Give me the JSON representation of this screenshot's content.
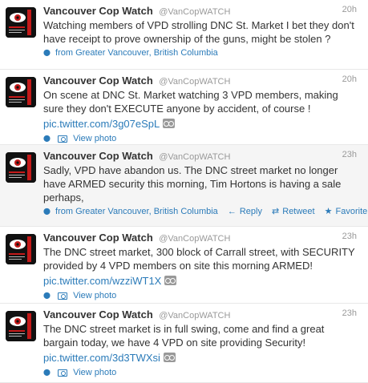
{
  "tweets": [
    {
      "fullname": "Vancouver Cop Watch",
      "username": "@VanCopWATCH",
      "time": "20h",
      "text": "Watching members of VPD strolling DNC St. Market I bet they don't have receipt to prove ownership of the guns, might be stolen ?",
      "location": "from Greater Vancouver, British Columbia"
    },
    {
      "fullname": "Vancouver Cop Watch",
      "username": "@VanCopWATCH",
      "time": "20h",
      "text": "On scene at DNC St. Market watching 3 VPD members, making sure they don't EXECUTE anyone by accident, of course !",
      "pic_link": "pic.twitter.com/3g07eSpL",
      "view_photo": "View photo"
    },
    {
      "fullname": "Vancouver Cop Watch",
      "username": "@VanCopWATCH",
      "time": "23h",
      "text": "Sadly, VPD have abandon us. The DNC street market no longer have ARMED security this morning, Tim Hortons is having a sale perhaps,",
      "location": "from Greater Vancouver, British Columbia",
      "actions": {
        "reply": "Reply",
        "retweet": "Retweet",
        "favorite": "Favorite"
      }
    },
    {
      "fullname": "Vancouver Cop Watch",
      "username": "@VanCopWATCH",
      "time": "23h",
      "text": "The DNC street market, 300 block of Carrall street, with SECURITY provided by 4 VPD members on site this morning ARMED!",
      "pic_link": "pic.twitter.com/wzziWT1X",
      "view_photo": "View photo"
    },
    {
      "fullname": "Vancouver Cop Watch",
      "username": "@VanCopWATCH",
      "time": "23h",
      "text": "The DNC street market is in full swing, come and find a great bargain today, we have 4 VPD on site providing Security!",
      "pic_link": "pic.twitter.com/3d3TWXsi",
      "view_photo": "View photo"
    }
  ],
  "avatar_logo_text": "COPWATCH",
  "icons": {
    "location": "map-pin-icon",
    "photo": "photo-icon",
    "pic": "pic-link-icon",
    "reply": "reply-arrow-icon",
    "retweet": "retweet-icon",
    "favorite": "star-icon"
  },
  "colors": {
    "link": "#2b7bb9",
    "text": "#333333",
    "muted": "#999999",
    "highlight": "#f5f5f5"
  }
}
